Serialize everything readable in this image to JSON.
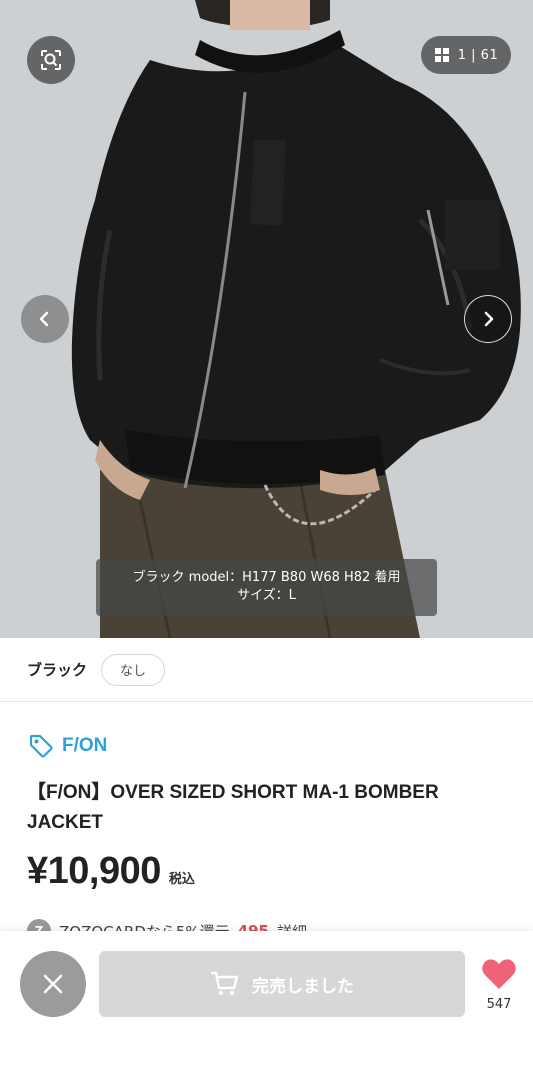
{
  "gallery": {
    "counter": "1 | 61",
    "caption_line1": "ブラック model：H177 B80 W68 H82 着用",
    "caption_line2": "サイズ：L"
  },
  "icons": {
    "zoom": "zoom-search-icon",
    "grid": "grid-icon",
    "prev": "chevron-left-icon",
    "next": "chevron-right-icon",
    "tag": "tag-icon",
    "close": "close-icon",
    "cart": "cart-icon",
    "heart": "heart-icon"
  },
  "variant": {
    "color": "ブラック",
    "size": "なし"
  },
  "product": {
    "brand": "F/ON",
    "title": "【F/ON】OVER SIZED SHORT MA-1 BOMBER JACKET",
    "price": "¥10,900",
    "tax_label": "税込"
  },
  "zozocard": {
    "icon_letter": "Z",
    "text": "ZOZOCARDなら5%還元",
    "points": "495",
    "detail": "詳細"
  },
  "actions": {
    "soldout_label": "完売しました",
    "favorite_count": "547"
  },
  "colors": {
    "brand_blue": "#2aa3d8",
    "heart_pink": "#f06277",
    "soldout_gray": "#d7d7d7"
  }
}
